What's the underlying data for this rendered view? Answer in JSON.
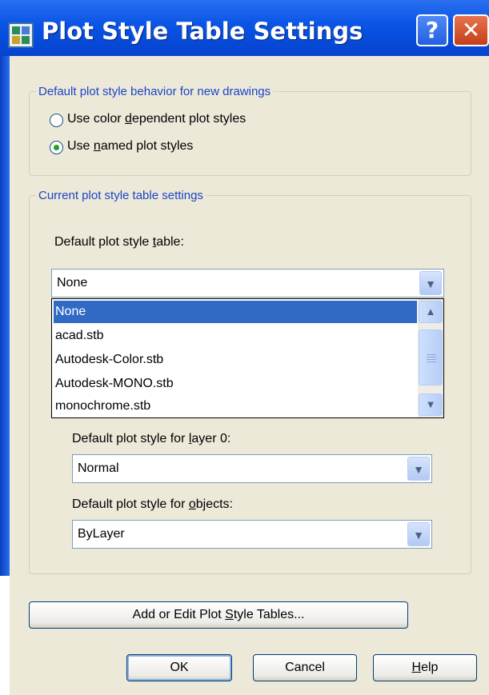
{
  "dialog": {
    "title": "Plot Style Table Settings",
    "help_glyph": "?",
    "close_glyph": "✕"
  },
  "behavior_group": {
    "legend": "Default plot style behavior for new drawings",
    "options": [
      {
        "pre": "Use color ",
        "key": "d",
        "post": "ependent plot styles",
        "checked": false
      },
      {
        "pre": "Use ",
        "key": "n",
        "post": "amed plot styles",
        "checked": true
      }
    ]
  },
  "current_group": {
    "legend": "Current plot style table settings",
    "table_label": {
      "pre": "Default plot style ",
      "key": "t",
      "post": "able:"
    },
    "table_value": "None",
    "table_options": [
      "None",
      "acad.stb",
      "Autodesk-Color.stb",
      "Autodesk-MONO.stb",
      "monochrome.stb"
    ],
    "selected_index": 0,
    "layer0_label": {
      "pre": "Default plot style for ",
      "key": "l",
      "post": "ayer 0:"
    },
    "layer0_value": "Normal",
    "objects_label": {
      "pre": "Default plot style for ",
      "key": "o",
      "post": "bjects:"
    },
    "objects_value": "ByLayer"
  },
  "buttons": {
    "add_edit": {
      "pre": "Add or Edit Plot ",
      "key": "S",
      "post": "tyle Tables..."
    },
    "ok": "OK",
    "cancel": "Cancel",
    "help": {
      "pre": "",
      "key": "H",
      "post": "elp"
    }
  },
  "icons": {
    "dropdown_arrow": "chevron-down-icon",
    "scroll_up": "chevron-up-icon",
    "app": "plot-style-table-icon"
  },
  "colors": {
    "title_bar": "#0a54e6",
    "group_legend": "#1b44c7",
    "selection": "#316ac5",
    "radio_dot": "#21a121"
  }
}
